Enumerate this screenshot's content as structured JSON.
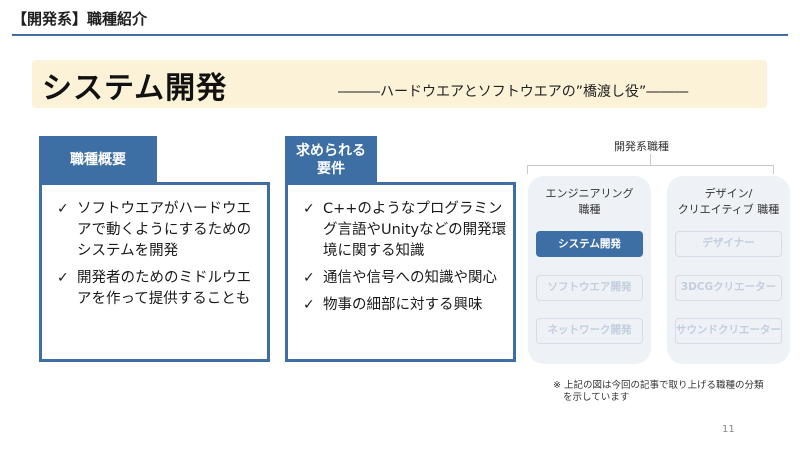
{
  "header": {
    "title": "【開発系】職種紹介"
  },
  "banner": {
    "title": "システム開発",
    "subtitle": "―――ハードウエアとソフトウエアの”橋渡し役”―――"
  },
  "overview_card": {
    "tab": "職種概要",
    "check_glyph": "✓",
    "items": [
      "ソフトウエアがハードウエアで動くようにするためのシステムを開発",
      "開発者のためのミドルウエアを作って提供することも"
    ]
  },
  "requirements_card": {
    "tab_line1": "求められる",
    "tab_line2": "要件",
    "check_glyph": "✓",
    "items": [
      "C++のようなプログラミング言語やUnityなどの開発環境に関する知識",
      "通信や信号への知識や関心",
      "物事の細部に対する興味"
    ]
  },
  "categories": {
    "heading": "開発系職種",
    "engineering": {
      "title_line1": "エンジニアリング",
      "title_line2": "職種",
      "items": [
        "システム開発",
        "ソフトウエア開発",
        "ネットワーク開発"
      ]
    },
    "creative": {
      "title_line1": "デザイン/",
      "title_line2": "クリエイティブ 職種",
      "items": [
        "デザイナー",
        "3DCGクリエーター",
        "サウンドクリエーター"
      ]
    }
  },
  "footnote": {
    "line1": "※ 上記の図は今回の記事で取り上げる職種の分類",
    "line2": "を示しています"
  },
  "page_number": "11",
  "colors": {
    "accent": "#3d6fa4",
    "banner_bg": "#fbf2d8",
    "panel_bg": "#eef1f6"
  }
}
